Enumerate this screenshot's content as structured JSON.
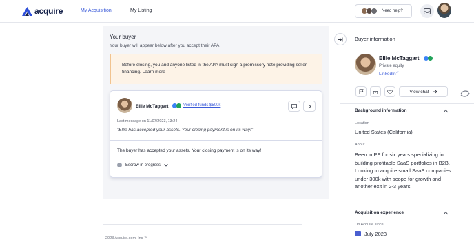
{
  "brand": {
    "name": "acquire"
  },
  "nav": {
    "items": [
      {
        "label": "My Acquisition"
      },
      {
        "label": "My Listing"
      }
    ],
    "help_label": "Need help?"
  },
  "main": {
    "section_title": "Your buyer",
    "section_subtitle": "Your buyer will appear below after you accept their APA.",
    "alert": {
      "text": "Before closing, you and anyone listed in the APA must sign a promissory note providing seller financing.",
      "link": "Learn more"
    },
    "buyer_card": {
      "name": "Ellie McTaggart",
      "verified": "Verified funds $500k",
      "last_message": "Last message on 11/07/2023, 13:24",
      "quote": "\"Ellie has accepted your assets. Your closing payment is on its way!\"",
      "status": "The buyer has accepted your assets. Your closing payment is on its way!",
      "escrow": "Escrow in progress"
    },
    "footer": "2023 Acquire.com, Inc ™"
  },
  "panel": {
    "title": "Buyer information",
    "name": "Ellie McTaggart",
    "subtitle": "Private equity",
    "linkedin": "LinkedIn",
    "view_chat": "View chat",
    "background": {
      "title": "Background information",
      "location_label": "Location",
      "location": "United States (California)",
      "about_label": "About",
      "about": "Been in PE for six years specializing in building profitable SaaS portfolios in B2B. Looking to acquire small SaaS companies under 300k with scope for growth and another exit in 2-3 years."
    },
    "acquisition": {
      "title": "Acquisition experience",
      "since_label": "On Acquire since",
      "since": "July 2023"
    }
  },
  "colors": {
    "accent": "#3b5bd9",
    "alert_bg": "#fdf3e7",
    "verified_blue": "#3b82f6",
    "verified_green": "#22a35a"
  }
}
